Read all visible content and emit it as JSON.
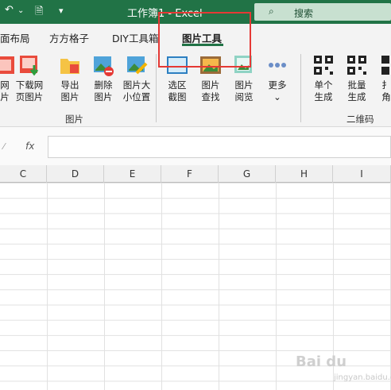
{
  "titlebar": {
    "title": "工作簿1  -  Excel",
    "search_label": "搜索"
  },
  "tabs": [
    {
      "label": "面布局"
    },
    {
      "label": "方方格子"
    },
    {
      "label": "DIY工具箱"
    },
    {
      "label": "图片工具",
      "active": true
    }
  ],
  "ribbon": {
    "buttons": [
      {
        "label": "网\n片",
        "icon": "link-image-icon"
      },
      {
        "label": "下载网\n页图片",
        "icon": "download-image-icon"
      },
      {
        "label": "导出\n图片",
        "icon": "export-folder-icon"
      },
      {
        "label": "删除\n图片",
        "icon": "delete-image-icon"
      },
      {
        "label": "图片大\n小位置",
        "icon": "resize-image-icon"
      },
      {
        "label": "选区\n截图",
        "icon": "screenshot-icon"
      },
      {
        "label": "图片\n查找",
        "icon": "find-image-icon"
      },
      {
        "label": "图片\n阅览",
        "icon": "view-image-icon"
      },
      {
        "label": "更多\n⌄",
        "icon": "more-dots-icon"
      },
      {
        "label": "单个\n生成",
        "icon": "qrcode-single-icon"
      },
      {
        "label": "批量\n生成",
        "icon": "qrcode-batch-icon"
      },
      {
        "label": "扌\n角",
        "icon": "partial-icon"
      }
    ],
    "group_image": "图片",
    "group_qrcode": "二维码"
  },
  "formula_bar": {
    "fx": "fx"
  },
  "columns": [
    "C",
    "D",
    "E",
    "F",
    "G",
    "H",
    "I"
  ],
  "watermark": "Bai du",
  "watermark_sub": "jingyan.baidu.com",
  "colors": {
    "accent": "#217346",
    "highlight": "#e53935"
  }
}
